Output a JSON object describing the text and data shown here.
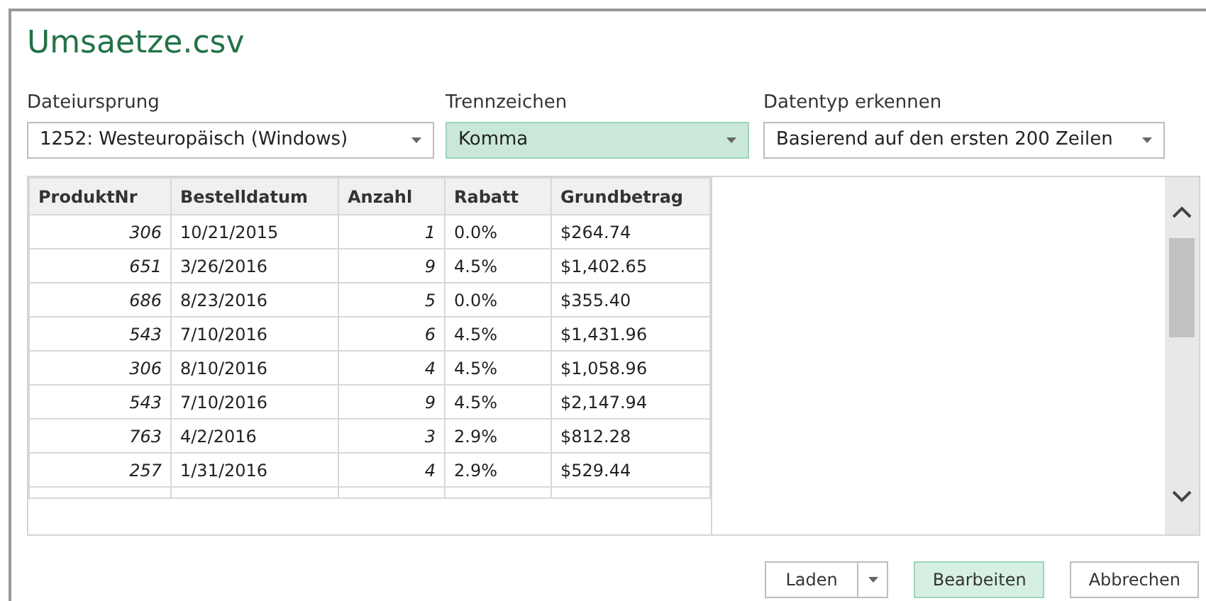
{
  "window": {
    "title": "Umsaetze.csv"
  },
  "options": [
    {
      "label": "Dateiursprung",
      "value": "1252: Westeuropäisch (Windows)",
      "highlighted": false
    },
    {
      "label": "Trennzeichen",
      "value": "Komma",
      "highlighted": true
    },
    {
      "label": "Datentyp erkennen",
      "value": "Basierend auf den ersten 200 Zeilen",
      "highlighted": false
    }
  ],
  "table": {
    "columns": [
      {
        "name": "ProduktNr",
        "kind": "number"
      },
      {
        "name": "Bestelldatum",
        "kind": "text"
      },
      {
        "name": "Anzahl",
        "kind": "number"
      },
      {
        "name": "Rabatt",
        "kind": "text"
      },
      {
        "name": "Grundbetrag",
        "kind": "text"
      }
    ],
    "rows": [
      [
        "306",
        "10/21/2015",
        "1",
        "0.0%",
        "$264.74"
      ],
      [
        "651",
        "3/26/2016",
        "9",
        "4.5%",
        "$1,402.65"
      ],
      [
        "686",
        "8/23/2016",
        "5",
        "0.0%",
        "$355.40"
      ],
      [
        "543",
        "7/10/2016",
        "6",
        "4.5%",
        "$1,431.96"
      ],
      [
        "306",
        "8/10/2016",
        "4",
        "4.5%",
        "$1,058.96"
      ],
      [
        "543",
        "7/10/2016",
        "9",
        "4.5%",
        "$2,147.94"
      ],
      [
        "763",
        "4/2/2016",
        "3",
        "2.9%",
        "$812.28"
      ],
      [
        "257",
        "1/31/2016",
        "4",
        "2.9%",
        "$529.44"
      ]
    ]
  },
  "buttons": [
    {
      "label": "Laden",
      "kind": "split",
      "primary": false
    },
    {
      "label": "Bearbeiten",
      "kind": "plain",
      "primary": true
    },
    {
      "label": "Abbrechen",
      "kind": "plain",
      "primary": false
    }
  ]
}
